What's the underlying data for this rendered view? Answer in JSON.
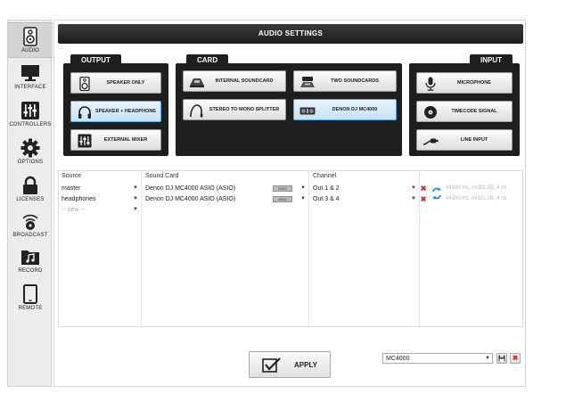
{
  "sidebar": {
    "items": [
      {
        "label": "AUDIO",
        "icon": "speaker-icon",
        "active": true
      },
      {
        "label": "INTERFACE",
        "icon": "monitor-icon"
      },
      {
        "label": "CONTROLLERS",
        "icon": "sliders-icon"
      },
      {
        "label": "OPTIONS",
        "icon": "gear-icon"
      },
      {
        "label": "LICENSES",
        "icon": "lock-icon"
      },
      {
        "label": "BROADCAST",
        "icon": "broadcast-icon"
      },
      {
        "label": "RECORD",
        "icon": "music-folder-icon"
      },
      {
        "label": "REMOTE",
        "icon": "tablet-icon"
      }
    ]
  },
  "header": {
    "title": "AUDIO SETTINGS"
  },
  "output": {
    "title": "OUTPUT",
    "buttons": [
      {
        "label": "SPEAKER ONLY",
        "icon": "speaker-icon",
        "selected": false
      },
      {
        "label": "SPEAKER + HEADPHONE",
        "icon": "headphones-icon",
        "selected": true
      },
      {
        "label": "EXTERNAL MIXER",
        "icon": "mixer-icon",
        "selected": false
      }
    ]
  },
  "card": {
    "title": "CARD",
    "buttons": [
      {
        "label": "INTERNAL SOUNDCARD",
        "icon": "soundcard-icon",
        "selected": false
      },
      {
        "label": "TWO SOUNDCARDS",
        "icon": "two-soundcards-icon",
        "selected": false
      },
      {
        "label": "STEREO TO MONO SPLITTER",
        "icon": "splitter-cable-icon",
        "selected": false
      },
      {
        "label": "DENON DJ MC4000",
        "icon": "controller-icon",
        "selected": true
      }
    ]
  },
  "input": {
    "title": "INPUT",
    "buttons": [
      {
        "label": "MICROPHONE",
        "icon": "microphone-icon"
      },
      {
        "label": "TIMECODE SIGNAL",
        "icon": "vinyl-icon"
      },
      {
        "label": "LINE INPUT",
        "icon": "cable-icon"
      }
    ]
  },
  "table": {
    "headers": {
      "source": "Source",
      "sound_card": "Sound Card",
      "channel": "Channel"
    },
    "rows": [
      {
        "source": "master",
        "sound_card": "Denon DJ MC4000 ASIO (ASIO)",
        "badge": "ASIO",
        "channel": "Out 1 & 2",
        "info": "44100 Hz, Int32LSB, 4 ch"
      },
      {
        "source": "headphones",
        "sound_card": "Denon DJ MC4000 ASIO (ASIO)",
        "badge": "ASIO",
        "channel": "Out 3 & 4",
        "info": "44100 Hz, Int32LSB, 4 ch"
      },
      {
        "source": "-- new --"
      }
    ]
  },
  "footer": {
    "apply_label": "APPLY",
    "preset_value": "MC4000"
  },
  "colors": {
    "selected_blue": "#c5e2f6",
    "panel_dark": "#1e1e1e",
    "delete_red": "#d0302a",
    "refresh_blue": "#2f8fd0"
  }
}
